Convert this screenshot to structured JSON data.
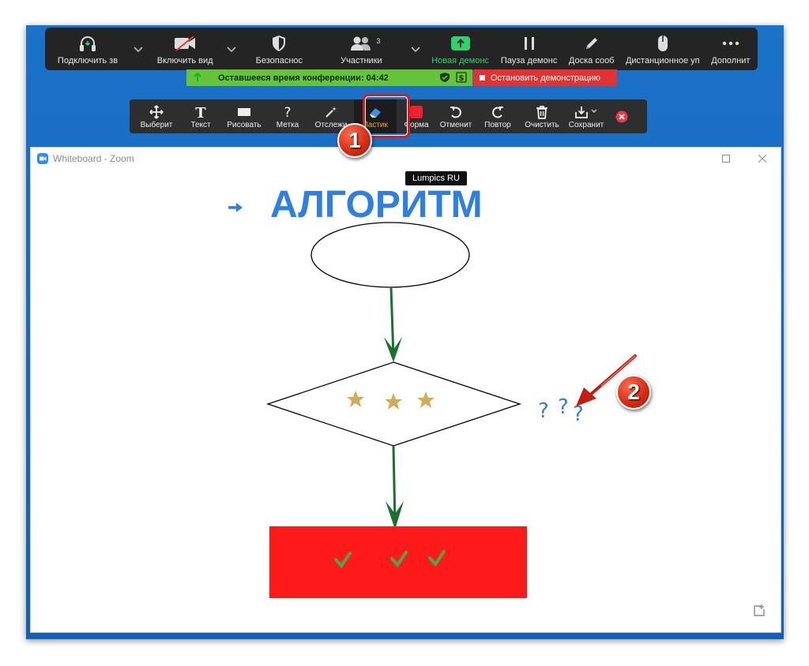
{
  "zoom_toolbar": {
    "items": [
      {
        "label": "Подключить зв",
        "icon": "headphones-icon"
      },
      {
        "label": "Включить вид",
        "icon": "video-off-icon"
      },
      {
        "label": "Безопаснос",
        "icon": "shield-icon"
      },
      {
        "label": "Участники",
        "icon": "participants-icon",
        "badge": "3"
      },
      {
        "label": "Новая демонс",
        "icon": "share-screen-icon"
      },
      {
        "label": "Пауза демонс",
        "icon": "pause-icon"
      },
      {
        "label": "Доска сооб",
        "icon": "pen-icon"
      },
      {
        "label": "Дистанционное уп",
        "icon": "mouse-icon"
      },
      {
        "label": "Дополнит",
        "icon": "more-icon"
      }
    ]
  },
  "status": {
    "remaining_time": "Оставшееся время конференции: 04:42",
    "stop_share": "Остановить демонстрацию"
  },
  "annotation_toolbar": {
    "tools": [
      {
        "label": "Выберит",
        "icon": "move-icon"
      },
      {
        "label": "Текст",
        "icon": "text-icon"
      },
      {
        "label": "Рисовать",
        "icon": "draw-icon"
      },
      {
        "label": "Метка",
        "icon": "stamp-icon"
      },
      {
        "label": "Отслежи",
        "icon": "spotlight-icon"
      },
      {
        "label": "Ластик",
        "icon": "eraser-icon",
        "active": true
      },
      {
        "label": "Форма",
        "icon": "format-icon"
      },
      {
        "label": "Отменит",
        "icon": "undo-icon"
      },
      {
        "label": "Повтор",
        "icon": "redo-icon"
      },
      {
        "label": "Очистить",
        "icon": "trash-icon"
      },
      {
        "label": "Сохранит",
        "icon": "save-icon"
      }
    ]
  },
  "callouts": {
    "one": "1",
    "two": "2"
  },
  "whiteboard": {
    "title": "Whiteboard - Zoom",
    "tooltip": "Lumpics RU",
    "heading": "АЛГОРИТМ",
    "question_marks": [
      "?",
      "?",
      "?"
    ]
  },
  "colors": {
    "accent_blue": "#2f7fe0",
    "arrow_green": "#1d6f2f",
    "box_red": "#ff1a1a",
    "star_gold": "#d1ad5a",
    "check_green": "#4aa84a"
  }
}
